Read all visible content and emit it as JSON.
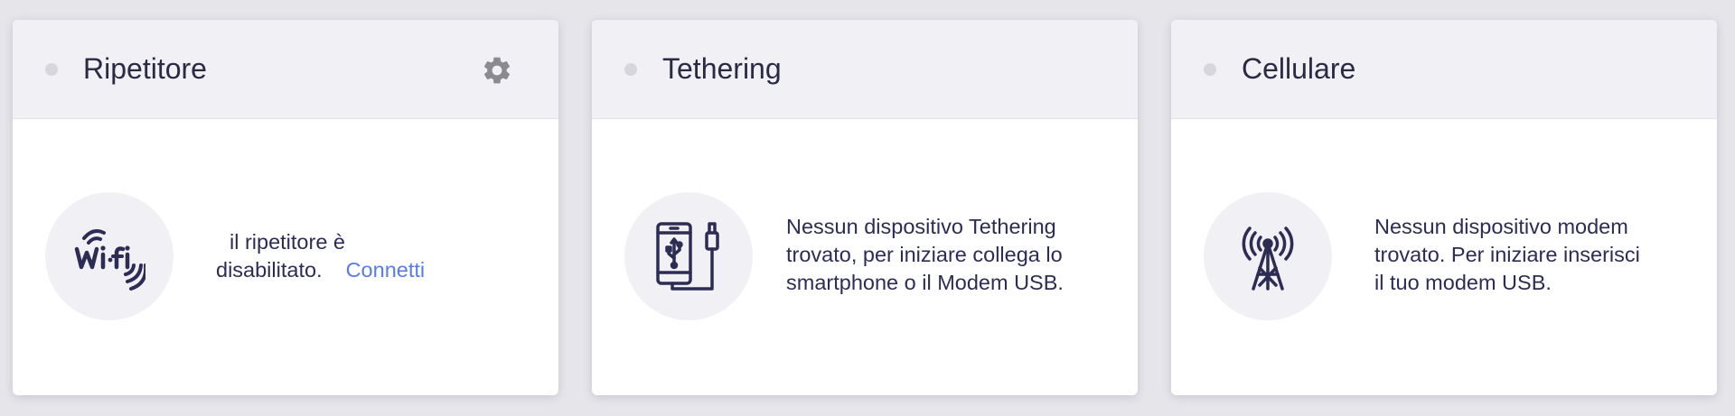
{
  "cards": [
    {
      "title": "Ripetitore",
      "icon": "wifi-icon",
      "message": "il ripetitore è disabilitato.",
      "message_line1": "il ripetitore è",
      "message_line2": "disabilitato.",
      "link": "Connetti"
    },
    {
      "title": "Tethering",
      "icon": "usb-smartphone-icon",
      "message_lines": [
        "Nessun dispositivo Tethering",
        "trovato, per iniziare collega lo",
        "smartphone o il Modem USB."
      ]
    },
    {
      "title": "Cellulare",
      "icon": "cell-tower-icon",
      "message_lines": [
        "Nessun dispositivo modem",
        "trovato. Per iniziare inserisci",
        "il tuo modem USB."
      ]
    }
  ],
  "colors": {
    "page_bg": "#e6e5ea",
    "header_bg": "#f1f0f5",
    "text": "#2c2c54",
    "link": "#5a7be6",
    "status_dot": "#d7d6dc",
    "gear": "#8a8a90"
  }
}
